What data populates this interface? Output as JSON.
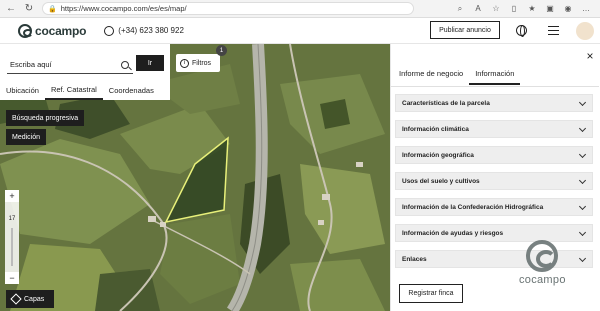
{
  "browser": {
    "url": "https://www.cocampo.com/es/es/map/"
  },
  "header": {
    "logo_text": "cocampo",
    "phone": "(+34) 623 380 922",
    "publish_label": "Publicar anuncio"
  },
  "search": {
    "placeholder": "Escriba aquí",
    "go_label": "Ir",
    "tabs": [
      "Ubicación",
      "Ref. Catastral",
      "Coordenadas"
    ],
    "active_tab": "Ref. Catastral"
  },
  "map": {
    "filters_label": "Filtros",
    "filters_count": "1",
    "progressive_search_label": "Búsqueda progresiva",
    "measure_label": "Medición",
    "zoom_level": "17",
    "zoom_in": "+",
    "zoom_out": "−",
    "layers_label": "Capas",
    "parcel_highlight_color": "#e8f07a"
  },
  "panel": {
    "tabs": [
      "Informe de negocio",
      "Información"
    ],
    "active_tab": "Información",
    "sections": [
      "Características de la parcela",
      "Información climática",
      "Información geográfica",
      "Usos del suelo y cultivos",
      "Información de la Confederación Hidrográfica",
      "Información de ayudas y riesgos",
      "Enlaces"
    ],
    "register_label": "Registrar finca",
    "watermark_text": "cocampo"
  }
}
